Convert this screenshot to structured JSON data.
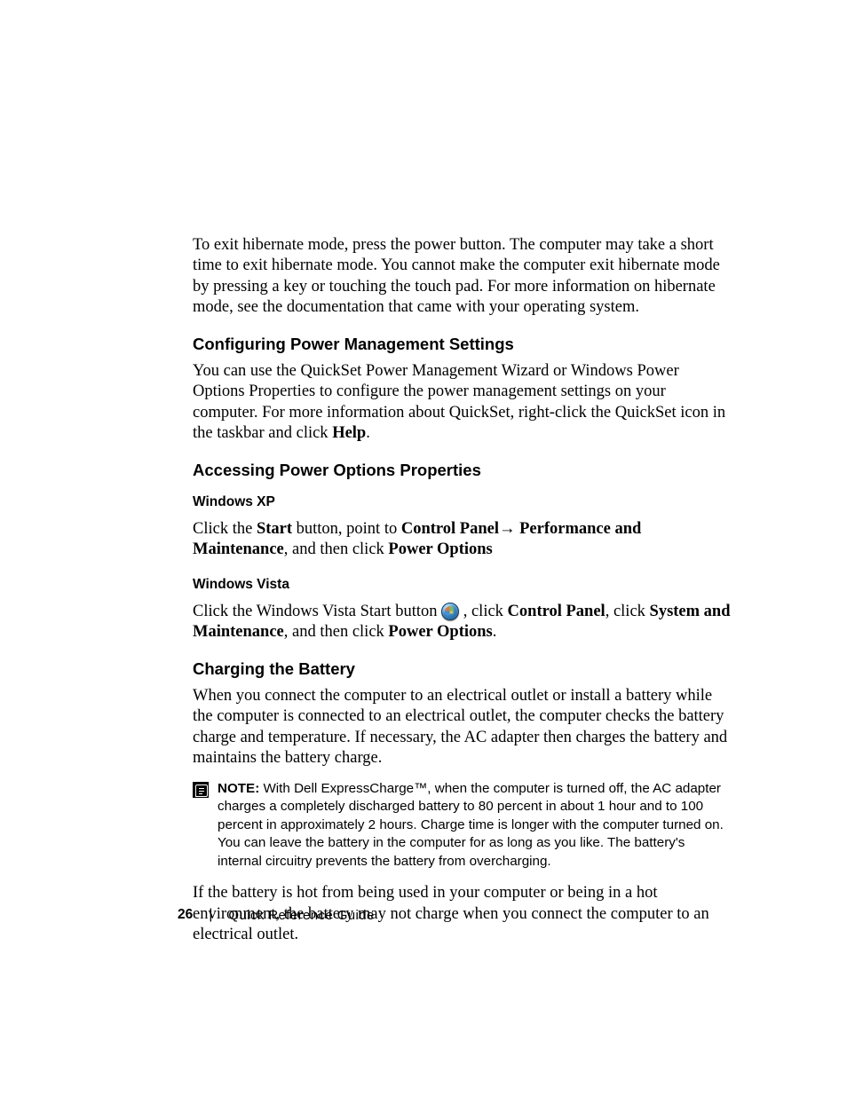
{
  "para_intro": "To exit hibernate mode, press the power button. The computer may take a short time to exit hibernate mode. You cannot make the computer exit hibernate mode by pressing a key or touching the touch pad. For more information on hibernate mode, see the documentation that came with your operating system.",
  "h_config": "Configuring Power Management Settings",
  "para_config_a": "You can use the QuickSet Power Management Wizard or Windows Power Options Properties to configure the power management settings on your computer. For more information about QuickSet, right-click the QuickSet icon in the taskbar and click ",
  "para_config_help": "Help",
  "para_config_b": ".",
  "h_access": "Accessing Power Options Properties",
  "h_xp": "Windows XP",
  "xp_a": "Click the ",
  "xp_start": "Start",
  "xp_b": " button, point to ",
  "xp_cp": "Control Panel",
  "xp_arrow": "→ ",
  "xp_perf": "Performance and Maintenance",
  "xp_c": ", and then click ",
  "xp_power": "Power Options",
  "h_vista": "Windows Vista",
  "vista_a": "Click the Windows Vista Start button ",
  "vista_b": " , click ",
  "vista_cp": "Control Panel",
  "vista_c": ", click ",
  "vista_sys": "System and Maintenance",
  "vista_d": ", and then click ",
  "vista_power": "Power Options",
  "vista_e": ".",
  "h_charging": "Charging the Battery",
  "para_charging": "When you connect the computer to an electrical outlet or install a battery while the computer is connected to an electrical outlet, the computer checks the battery charge and temperature. If necessary, the AC adapter then charges the battery and maintains the battery charge.",
  "note_label": "NOTE:",
  "note_body": " With Dell ExpressCharge™, when the computer is turned off, the AC adapter charges a completely discharged battery to 80 percent in about 1 hour and to 100 percent in approximately 2 hours. Charge time is longer with the computer turned on. You can leave the battery in the computer for as long as you like. The battery's internal circuitry prevents the battery from overcharging.",
  "para_hot": "If the battery is hot from being used in your computer or being in a hot environment, the battery may not charge when you connect the computer to an electrical outlet.",
  "footer_page": "26",
  "footer_title": "Quick Reference Guide"
}
